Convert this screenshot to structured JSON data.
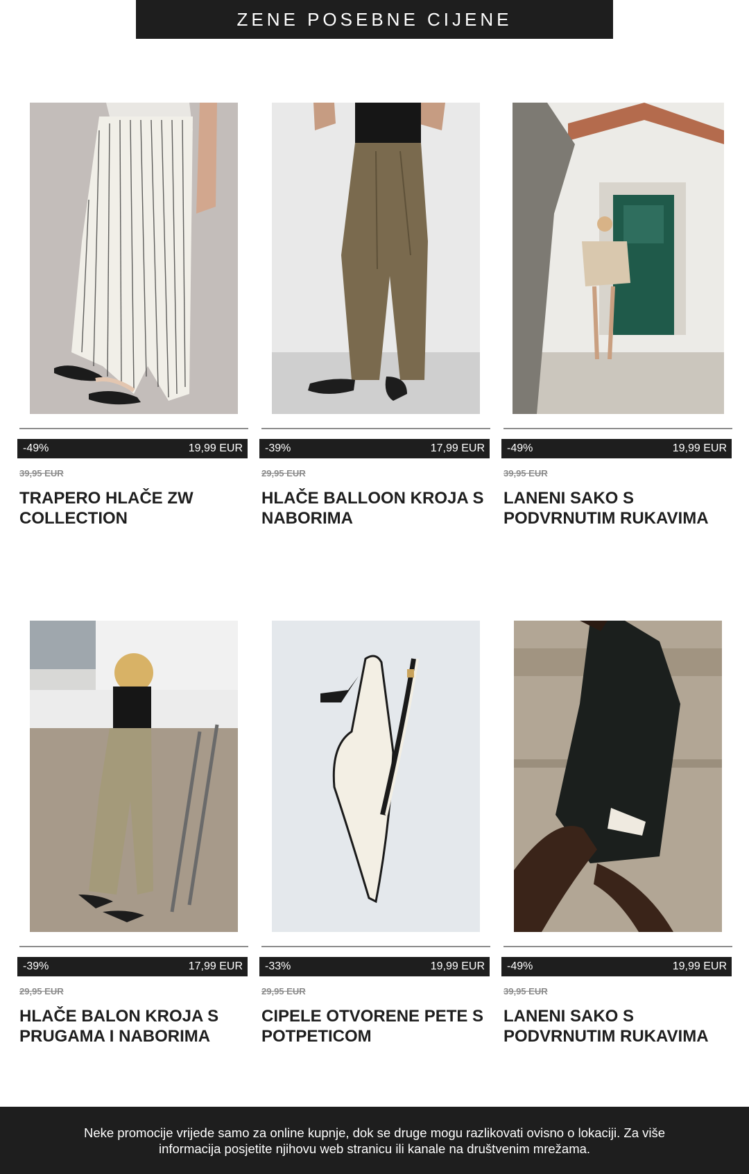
{
  "header": {
    "title": "ZENE POSEBNE CIJENE"
  },
  "products": [
    {
      "discount": "-49%",
      "price": "19,99 EUR",
      "old_price": "39,95 EUR",
      "title": "TRAPERO HLAČE ZW COLLECTION",
      "image": "striped-wide-trousers-photo"
    },
    {
      "discount": "-39%",
      "price": "17,99 EUR",
      "old_price": "29,95 EUR",
      "title": "HLAČE BALLOON KROJA S NABORIMA",
      "image": "khaki-balloon-trousers-photo"
    },
    {
      "discount": "-49%",
      "price": "19,99 EUR",
      "old_price": "39,95 EUR",
      "title": "LANENI SAKO S PODVRNUTIM RUKAVIMA",
      "image": "linen-blazer-doorway-photo"
    },
    {
      "discount": "-39%",
      "price": "17,99 EUR",
      "old_price": "29,95 EUR",
      "title": "HLAČE BALON KROJA S PRUGAMA I NABORIMA",
      "image": "beige-trousers-beach-photo"
    },
    {
      "discount": "-33%",
      "price": "19,99 EUR",
      "old_price": "29,95 EUR",
      "title": "CIPELE OTVORENE PETE S POTPETICOM",
      "image": "white-slingback-shoe-photo"
    },
    {
      "discount": "-49%",
      "price": "19,99 EUR",
      "old_price": "39,95 EUR",
      "title": "LANENI SAKO S PODVRNUTIM RUKAVIMA",
      "image": "black-blazer-photo"
    }
  ],
  "footer": {
    "text": "Neke promocije vrijede samo za online kupnje, dok se druge mogu razlikovati ovisno o lokaciji. Za više informacija posjetite njihovu web stranicu ili kanale na društvenim mrežama."
  }
}
